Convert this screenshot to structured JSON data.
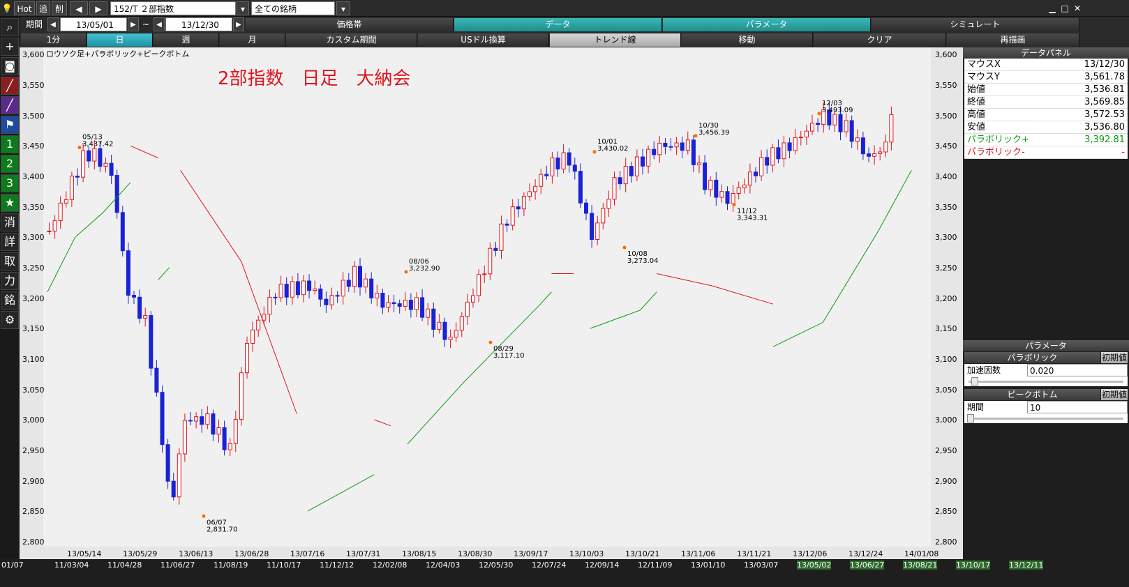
{
  "topbar": {
    "hot": "Hot",
    "add": "追",
    "del": "削",
    "symbol": "152/T ２部指数",
    "filter": "全ての銘柄"
  },
  "row2": {
    "period_label": "期間",
    "from": "13/05/01",
    "tilde": "~",
    "to": "13/12/30",
    "tabs": [
      "価格帯",
      "データ",
      "パラメータ",
      "シミュレート"
    ]
  },
  "row3": {
    "intervals": [
      "1分",
      "日",
      "週",
      "月",
      "カスタム期間",
      "USドル換算"
    ],
    "actions": [
      "トレンド線",
      "移動",
      "クリア",
      "再描画"
    ]
  },
  "left_tools": [
    {
      "name": "search-icon",
      "glyph": "⌕"
    },
    {
      "name": "crosshair-icon",
      "glyph": "+"
    },
    {
      "name": "camera-icon",
      "glyph": "◙"
    },
    {
      "name": "chart-red-icon",
      "glyph": "╱"
    },
    {
      "name": "chart-purple-icon",
      "glyph": "╱"
    },
    {
      "name": "flag-icon",
      "glyph": "⚑"
    },
    {
      "name": "one-icon",
      "glyph": "1"
    },
    {
      "name": "two-icon",
      "glyph": "2"
    },
    {
      "name": "three-icon",
      "glyph": "3"
    },
    {
      "name": "star-icon",
      "glyph": "★"
    },
    {
      "name": "erase-icon",
      "glyph": "消"
    },
    {
      "name": "detail-icon",
      "glyph": "詳"
    },
    {
      "name": "take-icon",
      "glyph": "取"
    },
    {
      "name": "power-icon",
      "glyph": "力"
    },
    {
      "name": "brand-icon",
      "glyph": "銘"
    },
    {
      "name": "settings-icon",
      "glyph": "⚙"
    }
  ],
  "chart": {
    "legend": "ロウソク足+パラボリック+ピークボトム",
    "title": "2部指数　日足　大納会",
    "y_ticks": [
      "3,600",
      "3,550",
      "3,500",
      "3,450",
      "3,400",
      "3,350",
      "3,300",
      "3,250",
      "3,200",
      "3,150",
      "3,100",
      "3,050",
      "3,000",
      "2,950",
      "2,900",
      "2,850",
      "2,800"
    ],
    "x_ticks": [
      "13/05/14",
      "13/05/29",
      "13/06/13",
      "13/06/28",
      "13/07/16",
      "13/07/31",
      "13/08/15",
      "13/08/30",
      "13/09/17",
      "13/10/03",
      "13/10/21",
      "13/11/06",
      "13/11/21",
      "13/12/06",
      "13/12/24",
      "14/01/08"
    ],
    "peak_labels": [
      {
        "date": "05/13",
        "value": "3,437.42"
      },
      {
        "date": "06/07",
        "value": "2,831.70"
      },
      {
        "date": "08/06",
        "value": "3,232.90"
      },
      {
        "date": "08/29",
        "value": "3,117.10"
      },
      {
        "date": "10/01",
        "value": "3,430.02"
      },
      {
        "date": "10/08",
        "value": "3,273.04"
      },
      {
        "date": "10/30",
        "value": "3,456.39"
      },
      {
        "date": "11/12",
        "value": "3,343.31"
      },
      {
        "date": "12/03",
        "value": "3,493.09"
      }
    ],
    "colors": {
      "up": "#e0121b",
      "down": "#1a22d6",
      "sar_up": "#0e9a0e",
      "sar_down": "#e0121b",
      "peak": "#ff6a00"
    }
  },
  "chart_data": {
    "type": "candlestick",
    "ylim": [
      2800,
      3620
    ],
    "peaks": [
      {
        "date": "13/05/13",
        "value": 3437.42
      },
      {
        "date": "13/06/07",
        "value": 2831.7
      },
      {
        "date": "13/08/06",
        "value": 3232.9
      },
      {
        "date": "13/08/29",
        "value": 3117.1
      },
      {
        "date": "13/10/01",
        "value": 3430.02
      },
      {
        "date": "13/10/08",
        "value": 3273.04
      },
      {
        "date": "13/10/30",
        "value": 3456.39
      },
      {
        "date": "13/11/12",
        "value": 3343.31
      },
      {
        "date": "13/12/03",
        "value": 3493.09
      }
    ],
    "last": {
      "open": 3536.81,
      "close": 3569.85,
      "high": 3572.53,
      "low": 3536.8
    }
  },
  "data_panel": {
    "title": "データパネル",
    "rows": [
      {
        "k": "マウスX",
        "v": "13/12/30"
      },
      {
        "k": "マウスY",
        "v": "3,561.78"
      },
      {
        "k": "始値",
        "v": "3,536.81"
      },
      {
        "k": "終値",
        "v": "3,569.85"
      },
      {
        "k": "高値",
        "v": "3,572.53"
      },
      {
        "k": "安値",
        "v": "3,536.80"
      },
      {
        "k": "パラボリック+",
        "v": "3,392.81"
      },
      {
        "k": "パラボリック-",
        "v": "-"
      }
    ]
  },
  "param_panel": {
    "title": "パラメータ",
    "parabolic": "パラボリック",
    "reset": "初期値",
    "accel_label": "加速因数",
    "accel": "0.020",
    "peakbottom": "ピークボトム",
    "period_label": "期間",
    "period": "10",
    "accel_level": 0.03,
    "period_level": 0.0
  },
  "bottom_dates": [
    "01/07",
    "11/03/04",
    "11/04/28",
    "11/06/27",
    "11/08/19",
    "11/10/17",
    "11/12/12",
    "12/02/08",
    "12/04/03",
    "12/05/30",
    "12/07/24",
    "12/09/14",
    "12/11/09",
    "13/01/10",
    "13/03/07",
    "13/05/02",
    "13/06/27",
    "13/08/21",
    "13/10/17",
    "13/12/11"
  ]
}
